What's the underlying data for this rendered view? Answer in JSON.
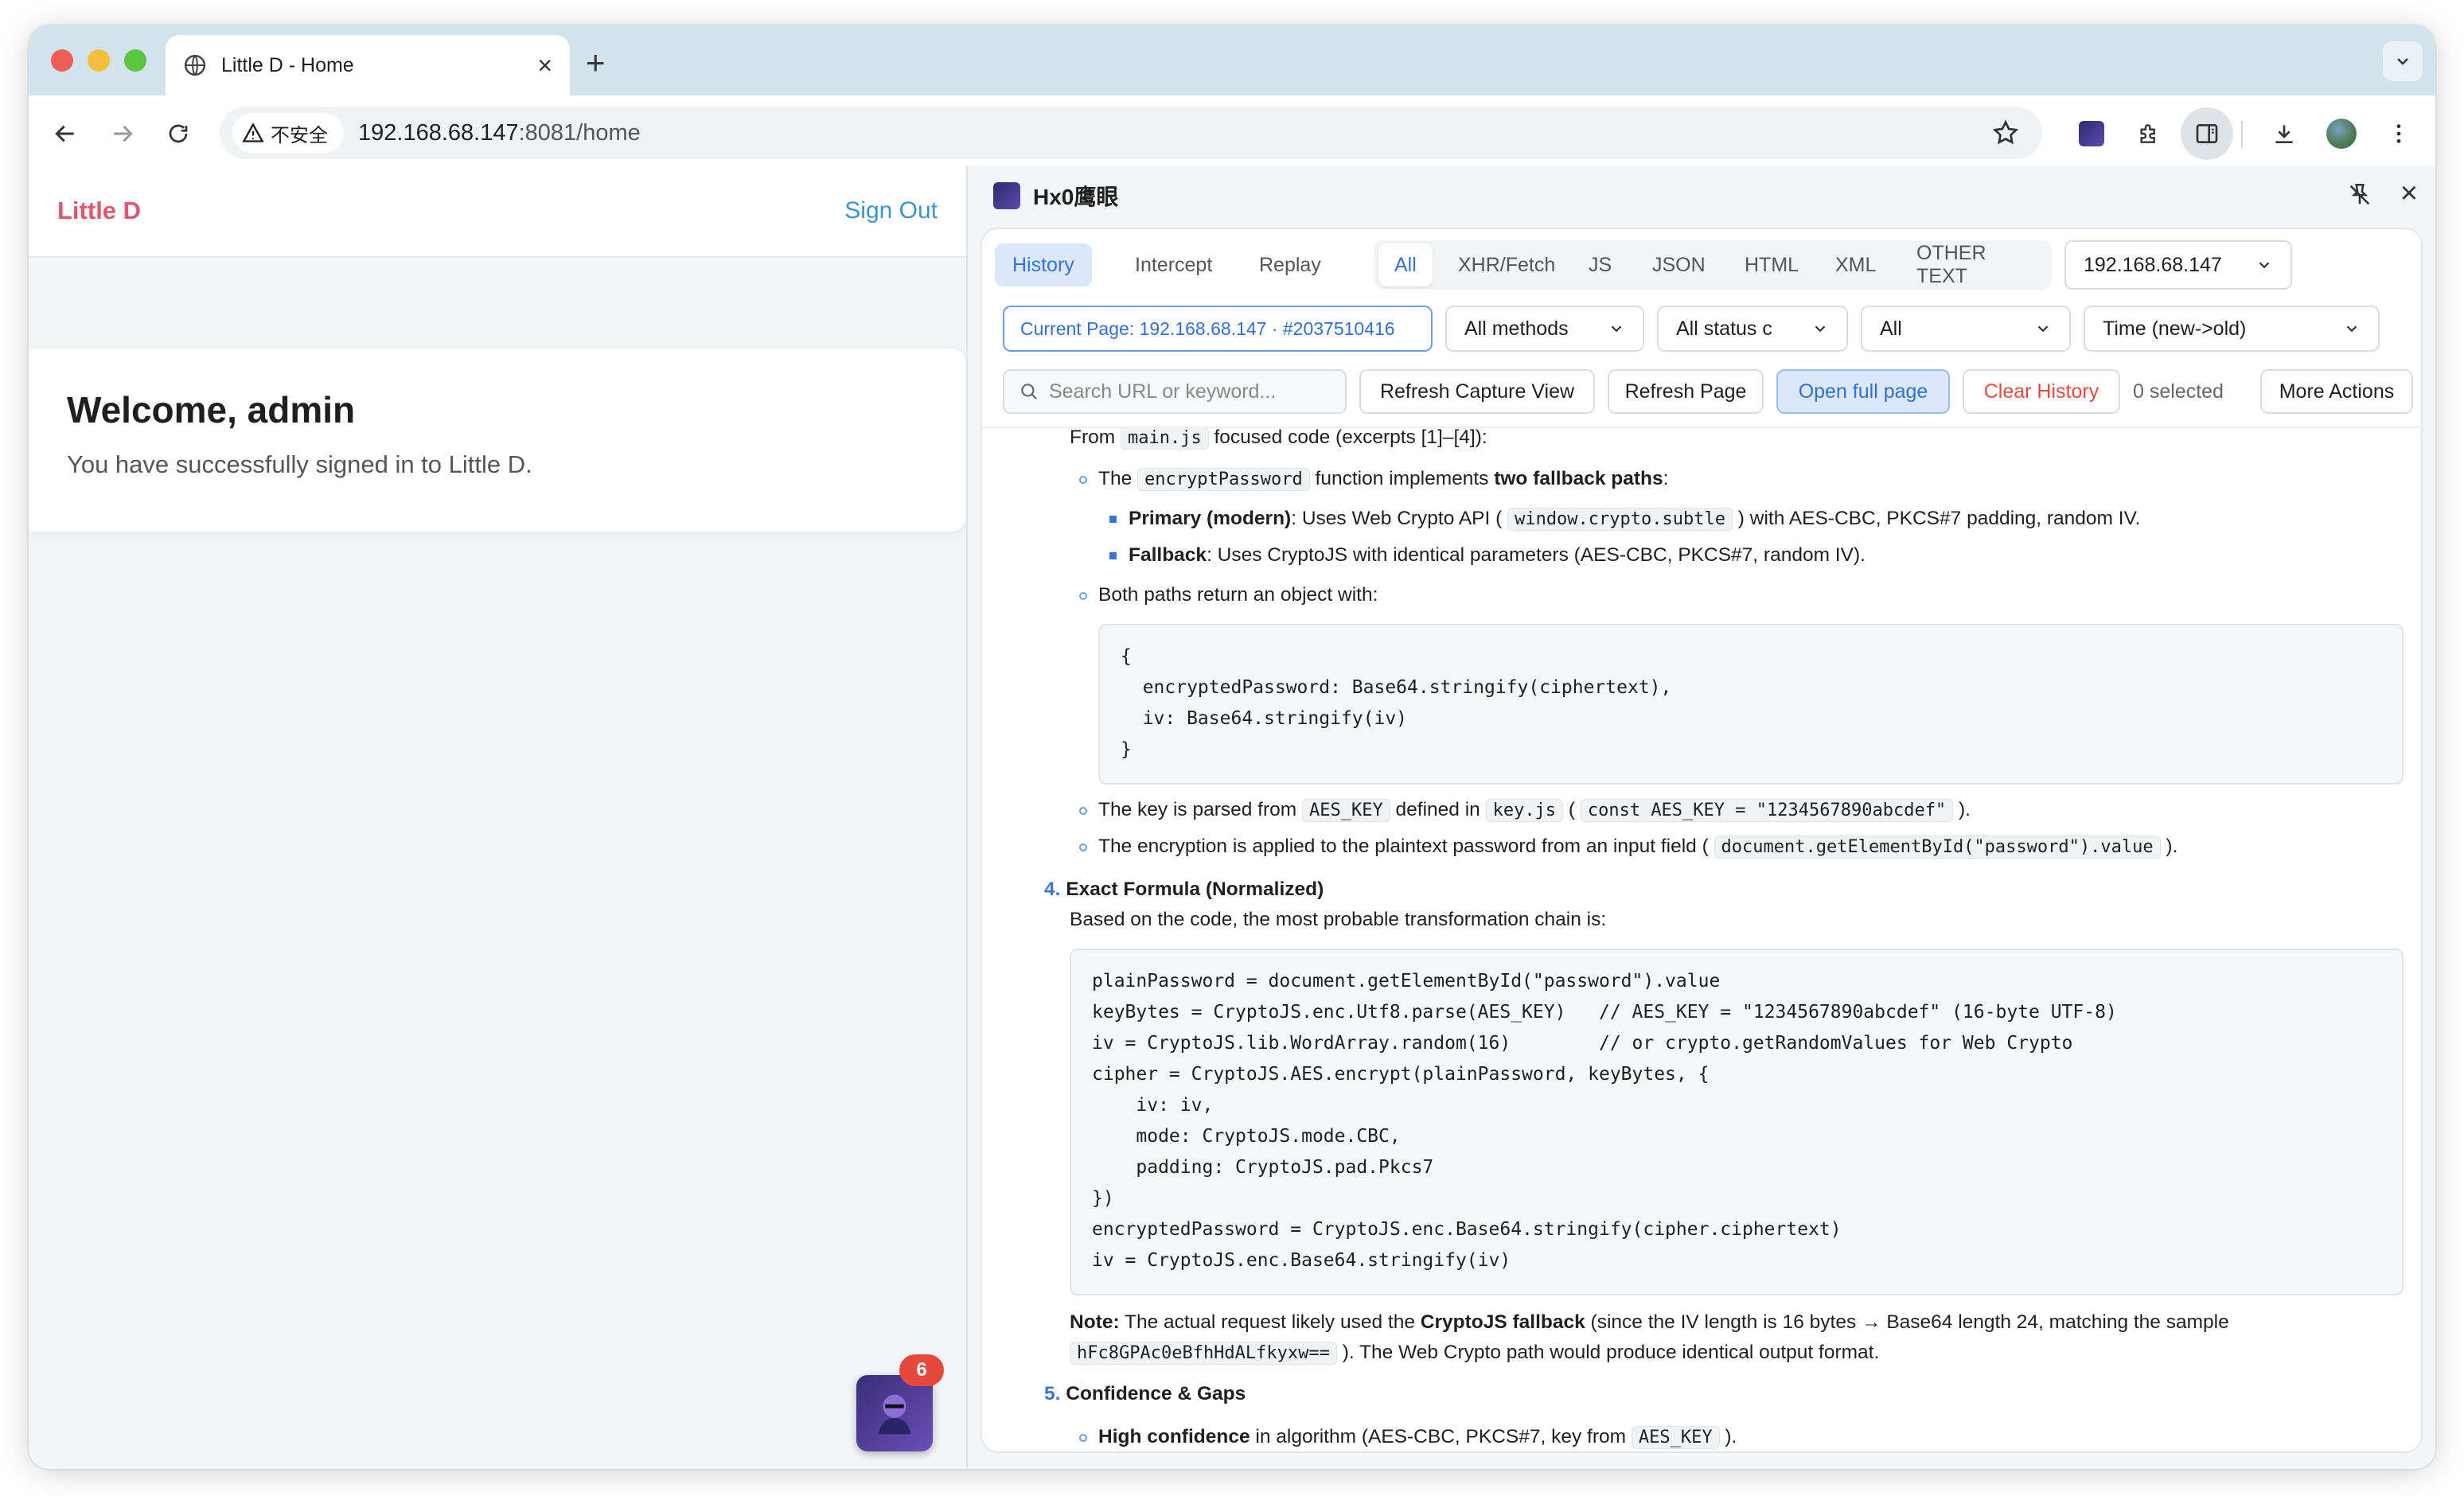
{
  "browser": {
    "tab_title": "Little D - Home",
    "security_label": "不安全",
    "url_host": "192.168.68.147",
    "url_rest": ":8081/home"
  },
  "app": {
    "brand": "Little D",
    "sign_out": "Sign Out",
    "welcome_title": "Welcome, admin",
    "welcome_text": "You have successfully signed in to Little D.",
    "badge_count": "6"
  },
  "panel": {
    "title": "Hx0鹰眼",
    "mode_tabs": [
      "History",
      "Intercept",
      "Replay"
    ],
    "filter_tabs": [
      "All",
      "XHR/Fetch",
      "JS",
      "JSON",
      "HTML",
      "XML",
      "OTHER TEXT"
    ],
    "host_select": "192.168.68.147",
    "current_page": "Current Page: 192.168.68.147 · #2037510416",
    "methods_select": "All methods",
    "status_select": "All status c",
    "all_select": "All",
    "sort_select": "Time (new->old)",
    "search_placeholder": "Search URL or keyword...",
    "buttons": {
      "refresh_capture": "Refresh Capture View",
      "refresh_page": "Refresh Page",
      "open_full": "Open full page",
      "clear_history": "Clear History",
      "selected": "0 selected",
      "more_actions": "More Actions"
    }
  },
  "analysis": {
    "l1_pre": "From ",
    "l1_code": "main.js",
    "l1_post": " focused code (excerpts [1]–[4]):",
    "l2_pre": "The ",
    "l2_code": "encryptPassword",
    "l2_mid": " function implements ",
    "l2_bold": "two fallback paths",
    "l2_post": ":",
    "l3_bold": "Primary (modern)",
    "l3_pre": ": Uses Web Crypto API ( ",
    "l3_code": "window.crypto.subtle",
    "l3_post": " ) with AES-CBC, PKCS#7 padding, random IV.",
    "l4_bold": "Fallback",
    "l4_post": ": Uses CryptoJS with identical parameters (AES-CBC, PKCS#7, random IV).",
    "l5": "Both paths return an object with:",
    "code1": "{\n  encryptedPassword: Base64.stringify(ciphertext),\n  iv: Base64.stringify(iv)\n}",
    "l6_pre": "The key is parsed from ",
    "l6_code1": "AES_KEY",
    "l6_mid": " defined in ",
    "l6_code2": "key.js",
    "l6_open": " ( ",
    "l6_code3": "const AES_KEY = \"1234567890abcdef\"",
    "l6_post": " ).",
    "l7_pre": "The encryption is applied to the plaintext password from an input field ( ",
    "l7_code": "document.getElementById(\"password\").value",
    "l7_post": " ).",
    "s4_num": "4.",
    "s4_title": "Exact Formula (Normalized)",
    "s4_text": "Based on the code, the most probable transformation chain is:",
    "code2": "plainPassword = document.getElementById(\"password\").value\nkeyBytes = CryptoJS.enc.Utf8.parse(AES_KEY)   // AES_KEY = \"1234567890abcdef\" (16-byte UTF-8)\niv = CryptoJS.lib.WordArray.random(16)        // or crypto.getRandomValues for Web Crypto\ncipher = CryptoJS.AES.encrypt(plainPassword, keyBytes, {\n    iv: iv,\n    mode: CryptoJS.mode.CBC,\n    padding: CryptoJS.pad.Pkcs7\n})\nencryptedPassword = CryptoJS.enc.Base64.stringify(cipher.ciphertext)\niv = CryptoJS.enc.Base64.stringify(iv)",
    "note_bold": "Note:",
    "note_pre": " The actual request likely used the ",
    "note_bold2": "CryptoJS fallback",
    "note_post": " (since the IV length is 16 bytes → Base64 length 24, matching the sample",
    "note_code": "hFc8GPAc0eBfhHdALfkyxw==",
    "note_post2": " ). The Web Crypto path would produce identical output format.",
    "s5_num": "5.",
    "s5_title": "Confidence & Gaps",
    "l8_bold": "High confidence",
    "l8_pre": " in algorithm (AES-CBC, PKCS#7, key from ",
    "l8_code": "AES_KEY",
    "l8_post": " )."
  },
  "colors": {
    "brand": "#e1566f",
    "link": "#3b93cf",
    "accent": "#3571d8",
    "danger": "#e34a3c"
  },
  "icons": [
    "globe-icon",
    "back-icon",
    "forward-icon",
    "reload-icon",
    "warning-icon",
    "star-icon",
    "extension-icon",
    "puzzle-icon",
    "side-panel-icon",
    "download-icon",
    "avatar",
    "more-icon",
    "pin-icon",
    "close-icon",
    "search-icon",
    "chevron-down-icon"
  ]
}
